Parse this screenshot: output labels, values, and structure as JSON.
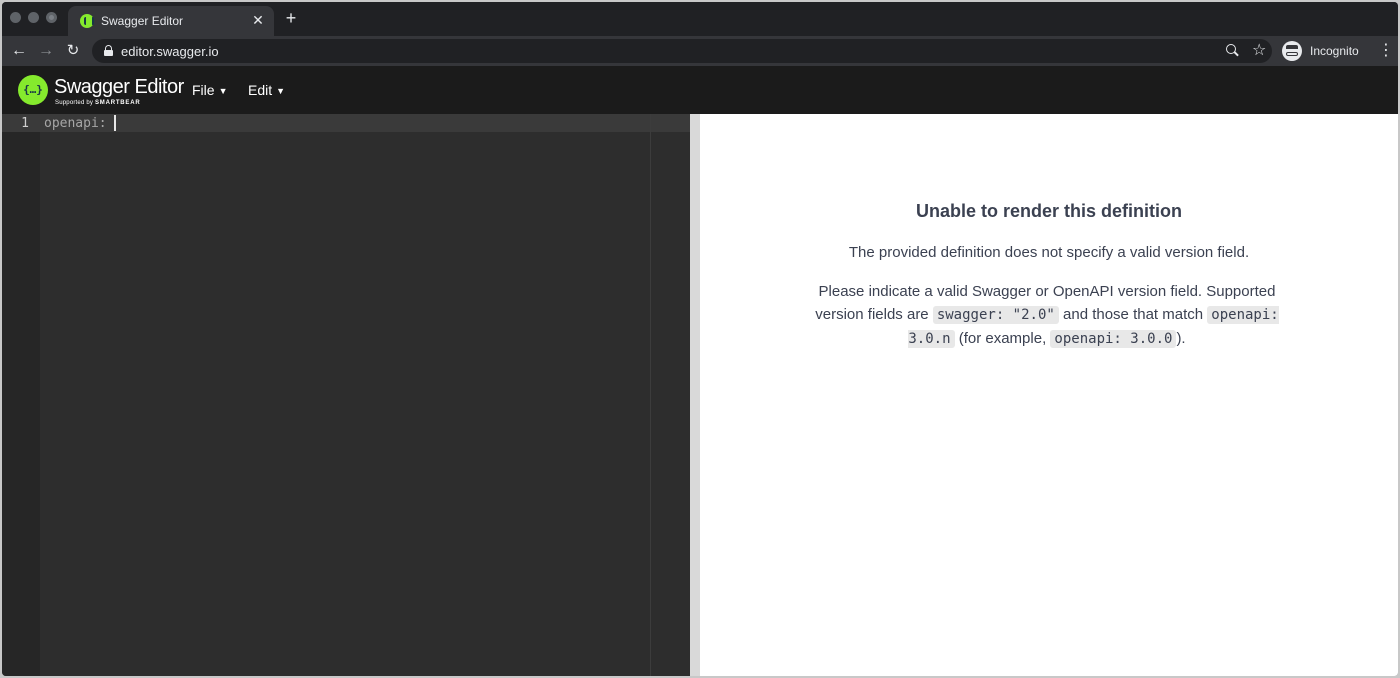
{
  "browser": {
    "tab": {
      "title": "Swagger Editor",
      "close_glyph": "✕"
    },
    "new_tab_glyph": "+",
    "nav": {
      "back_glyph": "←",
      "forward_glyph": "→",
      "reload_glyph": "↻"
    },
    "url": "editor.swagger.io",
    "star_glyph": "☆",
    "incognito_label": "Incognito",
    "menu_glyph": "⋮"
  },
  "app": {
    "logo_mark": "{…}",
    "logo_text": "Swagger Editor",
    "logo_sub_prefix": "Supported by",
    "logo_sub_brand": "SMARTBEAR",
    "menu": {
      "file_label": "File",
      "edit_label": "Edit",
      "caret": "▼"
    },
    "accent": "#85ea2d"
  },
  "editor": {
    "line_number": "1",
    "code": "openapi:"
  },
  "preview": {
    "title": "Unable to render this definition",
    "description": "The provided definition does not specify a valid version field.",
    "help_text_1": "Please indicate a valid Swagger or OpenAPI version field. Supported version fields are",
    "code_swagger": "swagger: \"2.0\"",
    "help_text_2": "and those that match",
    "code_openapi_pattern": "openapi: 3.0.n",
    "help_text_3": "(for example,",
    "code_openapi_example": "openapi: 3.0.0",
    "help_text_4": ")."
  }
}
